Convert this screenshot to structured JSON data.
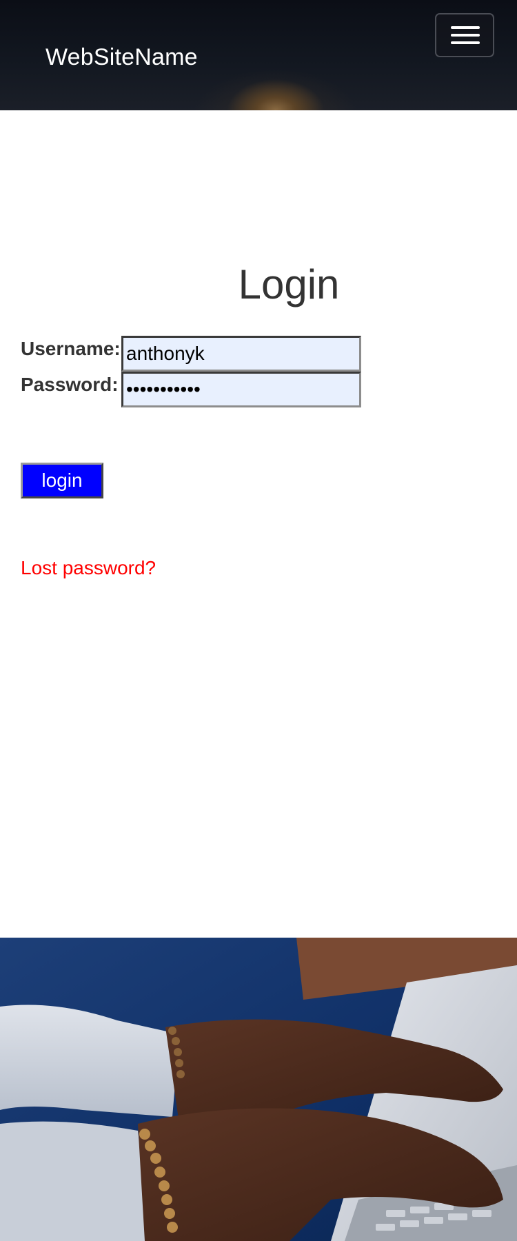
{
  "header": {
    "site_name": "WebSiteName",
    "menu_icon": "hamburger-menu-icon"
  },
  "login": {
    "title": "Login",
    "username_label": "Username:",
    "username_value": "anthonyk",
    "password_label": "Password:",
    "password_value": "•••••••••••",
    "submit_label": "login",
    "lost_password_label": "Lost password?"
  },
  "colors": {
    "button_bg": "#0000ff",
    "link": "#ff0000",
    "input_bg": "#e8f0fe",
    "header_bg": "#0b0e16"
  }
}
